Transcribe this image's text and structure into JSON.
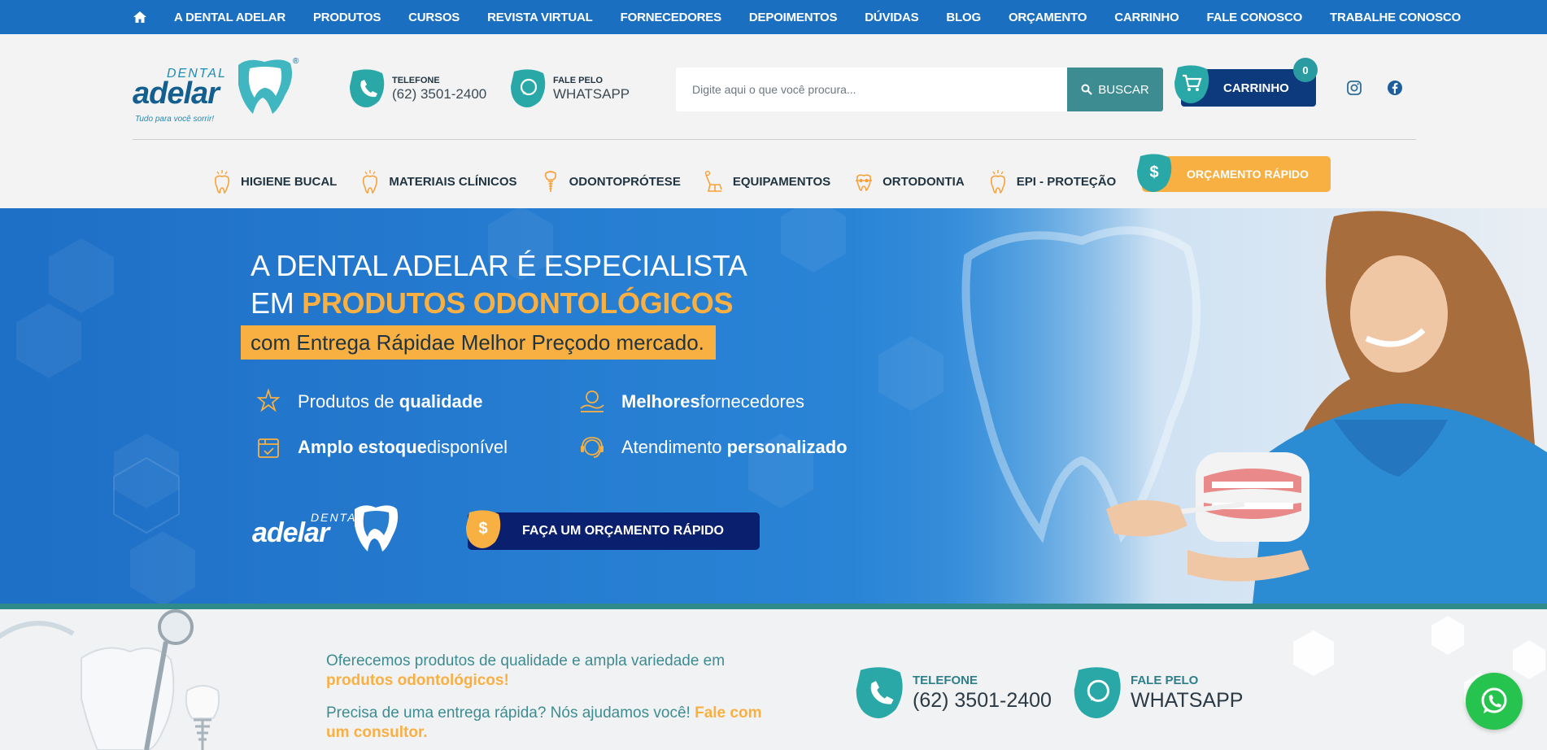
{
  "topnav": {
    "home_icon": "home-icon",
    "items": [
      "A DENTAL ADELAR",
      "PRODUTOS",
      "CURSOS",
      "REVISTA VIRTUAL",
      "FORNECEDORES",
      "DEPOIMENTOS",
      "DÚVIDAS",
      "BLOG",
      "ORÇAMENTO",
      "CARRINHO",
      "FALE CONOSCO",
      "TRABALHE CONOSCO"
    ]
  },
  "logo": {
    "small": "DENTAL",
    "big": "adelar",
    "tagline": "Tudo para você sorrir!",
    "reg": "®"
  },
  "header": {
    "phone_label": "TELEFONE",
    "phone_value": "(62) 3501-2400",
    "whatsapp_label": "FALE PELO",
    "whatsapp_value": "WHATSAPP",
    "search_placeholder": "Digite aqui o que você procura...",
    "search_button": "BUSCAR",
    "cart_label": "CARRINHO",
    "cart_count": "0"
  },
  "categories": [
    {
      "label": "HIGIENE BUCAL",
      "icon": "tooth-icon"
    },
    {
      "label": "MATERIAIS CLÍNICOS",
      "icon": "tooth-icon"
    },
    {
      "label": "ODONTOPRÓTESE",
      "icon": "implant-icon"
    },
    {
      "label": "EQUIPAMENTOS",
      "icon": "dental-chair-icon"
    },
    {
      "label": "ORTODONTIA",
      "icon": "braces-icon"
    },
    {
      "label": "EPI - PROTEÇÃO",
      "icon": "tooth-icon"
    }
  ],
  "quick_quote": "ORÇAMENTO RÁPIDO",
  "hero": {
    "line1": "A DENTAL ADELAR É ESPECIALISTA",
    "line2_pre": "EM ",
    "line2_hl": "PRODUTOS ODONTOLÓGICOS",
    "band_pre": "com ",
    "band_a": "Entrega Rápida",
    "band_mid": " e ",
    "band_b": "Melhor Preço",
    "band_post": " do mercado.",
    "features": [
      {
        "pre": "Produtos de ",
        "bold": "qualidade",
        "post": ""
      },
      {
        "pre": "",
        "bold": "Melhores",
        "post": " fornecedores"
      },
      {
        "pre": "",
        "bold": "Amplo estoque",
        "post": " disponível"
      },
      {
        "pre": "Atendimento ",
        "bold": "personalizado",
        "post": ""
      }
    ],
    "logo_small": "DENTAL",
    "logo_big": "adelar",
    "cta": "FAÇA UM ORÇAMENTO RÁPIDO"
  },
  "bottom": {
    "p1_pre": "Oferecemos produtos de qualidade e ampla variedade em ",
    "p1_hl": "produtos odontológicos!",
    "p2_pre": "Precisa de uma entrega rápida? Nós ajudamos você! ",
    "p2_hl": "Fale com um consultor.",
    "phone_label": "TELEFONE",
    "phone_value": "(62) 3501-2400",
    "whatsapp_label": "FALE PELO",
    "whatsapp_value": "WHATSAPP"
  },
  "colors": {
    "nav_blue": "#1b6fc0",
    "teal": "#2a9ba0",
    "orange": "#f8b043",
    "navy": "#0d3a7c",
    "whatsapp_green": "#27c34f"
  }
}
